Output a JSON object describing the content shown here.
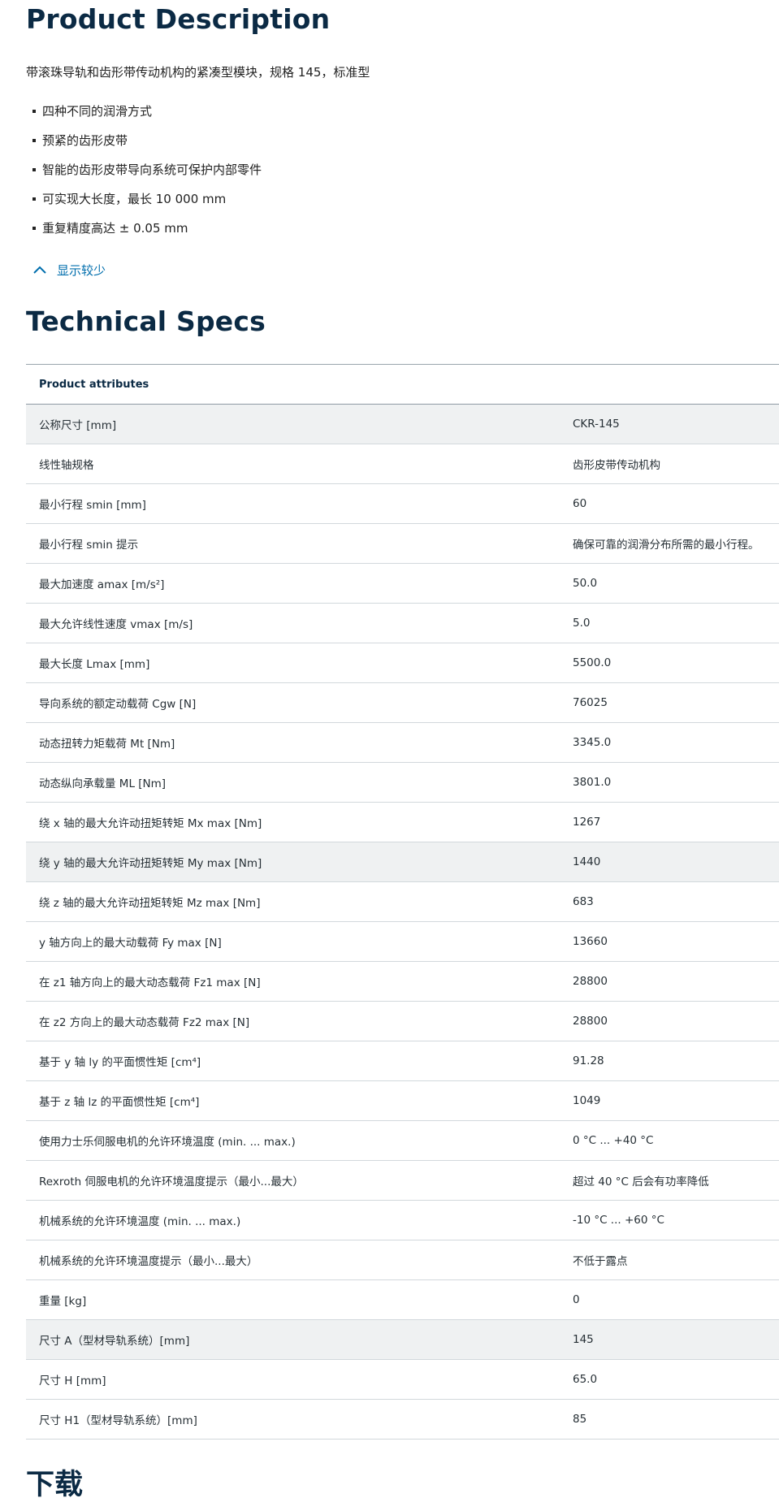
{
  "product": {
    "title": "Product Description",
    "intro": "带滚珠导轨和齿形带传动机构的紧凑型模块，规格 145，标准型",
    "features": [
      "四种不同的润滑方式",
      "预紧的齿形皮带",
      "智能的齿形皮带导向系统可保护内部零件",
      "可实现大长度，最长 10 000 mm",
      "重复精度高达 ± 0.05 mm"
    ],
    "toggle_label": "显示较少",
    "toggle_icon": "chevron-up-icon"
  },
  "specs": {
    "title": "Technical Specs",
    "header": "Product attributes",
    "rows": [
      {
        "label": "公称尺寸 [mm]",
        "value": "CKR-145",
        "shaded": true
      },
      {
        "label": "线性轴规格",
        "value": "齿形皮带传动机构",
        "shaded": false
      },
      {
        "label": "最小行程 smin [mm]",
        "value": "60",
        "shaded": false
      },
      {
        "label": "最小行程 smin 提示",
        "value": "确保可靠的润滑分布所需的最小行程。",
        "shaded": false
      },
      {
        "label": "最大加速度 amax [m/s²]",
        "value": "50.0",
        "shaded": false
      },
      {
        "label": "最大允许线性速度 vmax [m/s]",
        "value": "5.0",
        "shaded": false
      },
      {
        "label": "最大长度 Lmax [mm]",
        "value": "5500.0",
        "shaded": false
      },
      {
        "label": "导向系统的额定动载荷 Cgw [N]",
        "value": "76025",
        "shaded": false
      },
      {
        "label": "动态扭转力矩载荷 Mt [Nm]",
        "value": "3345.0",
        "shaded": false
      },
      {
        "label": "动态纵向承载量 ML [Nm]",
        "value": "3801.0",
        "shaded": false
      },
      {
        "label": "绕 x 轴的最大允许动扭矩转矩 Mx max [Nm]",
        "value": "1267",
        "shaded": false
      },
      {
        "label": "绕 y 轴的最大允许动扭矩转矩 My max [Nm]",
        "value": "1440",
        "shaded": true
      },
      {
        "label": "绕 z 轴的最大允许动扭矩转矩 Mz max [Nm]",
        "value": "683",
        "shaded": false
      },
      {
        "label": "y 轴方向上的最大动载荷 Fy max [N]",
        "value": "13660",
        "shaded": false
      },
      {
        "label": "在 z1 轴方向上的最大动态载荷 Fz1 max [N]",
        "value": "28800",
        "shaded": false
      },
      {
        "label": "在 z2 方向上的最大动态载荷 Fz2 max [N]",
        "value": "28800",
        "shaded": false
      },
      {
        "label": "基于 y 轴 ly 的平面惯性矩 [cm⁴]",
        "value": "91.28",
        "shaded": false
      },
      {
        "label": "基于 z 轴 lz 的平面惯性矩 [cm⁴]",
        "value": "1049",
        "shaded": false
      },
      {
        "label": "使用力士乐伺服电机的允许环境温度 (min. ... max.)",
        "value": "0 °C ... +40 °C",
        "shaded": false
      },
      {
        "label": "Rexroth 伺服电机的允许环境温度提示（最小...最大）",
        "value": "超过 40 °C 后会有功率降低",
        "shaded": false
      },
      {
        "label": "机械系统的允许环境温度 (min. ... max.)",
        "value": "-10 °C ... +60 °C",
        "shaded": false
      },
      {
        "label": "机械系统的允许环境温度提示（最小...最大）",
        "value": "不低于露点",
        "shaded": false
      },
      {
        "label": "重量 [kg]",
        "value": "0",
        "shaded": false
      },
      {
        "label": "尺寸 A（型材导轨系统）[mm]",
        "value": "145",
        "shaded": true
      },
      {
        "label": "尺寸 H [mm]",
        "value": "65.0",
        "shaded": false
      },
      {
        "label": "尺寸 H1（型材导轨系统）[mm]",
        "value": "85",
        "shaded": false
      }
    ]
  },
  "downloads": {
    "title": "下载"
  }
}
